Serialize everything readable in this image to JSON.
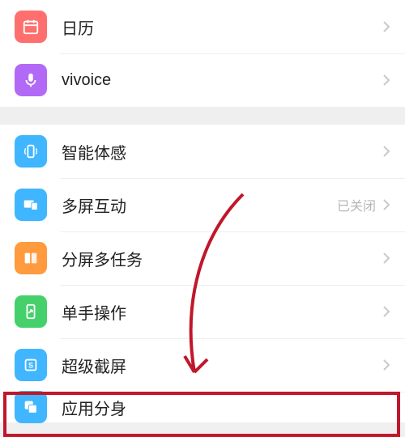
{
  "group1": {
    "items": [
      {
        "label": "日历",
        "icon": "calendar-icon",
        "color": "#ff6f6d",
        "status": ""
      },
      {
        "label": "vivoice",
        "icon": "mic-icon",
        "color": "#b26af6",
        "status": ""
      }
    ]
  },
  "group2": {
    "items": [
      {
        "label": "智能体感",
        "icon": "phone-motion-icon",
        "color": "#3fb6ff",
        "status": ""
      },
      {
        "label": "多屏互动",
        "icon": "multiscreen-icon",
        "color": "#3fb6ff",
        "status": "已关闭"
      },
      {
        "label": "分屏多任务",
        "icon": "splitscreen-icon",
        "color": "#ff9a3e",
        "status": ""
      },
      {
        "label": "单手操作",
        "icon": "onehand-icon",
        "color": "#46d06b",
        "status": ""
      },
      {
        "label": "超级截屏",
        "icon": "screenshot-icon",
        "color": "#3fb6ff",
        "status": ""
      },
      {
        "label": "应用分身",
        "icon": "appclone-icon",
        "color": "#3fb6ff",
        "status": ""
      }
    ]
  }
}
